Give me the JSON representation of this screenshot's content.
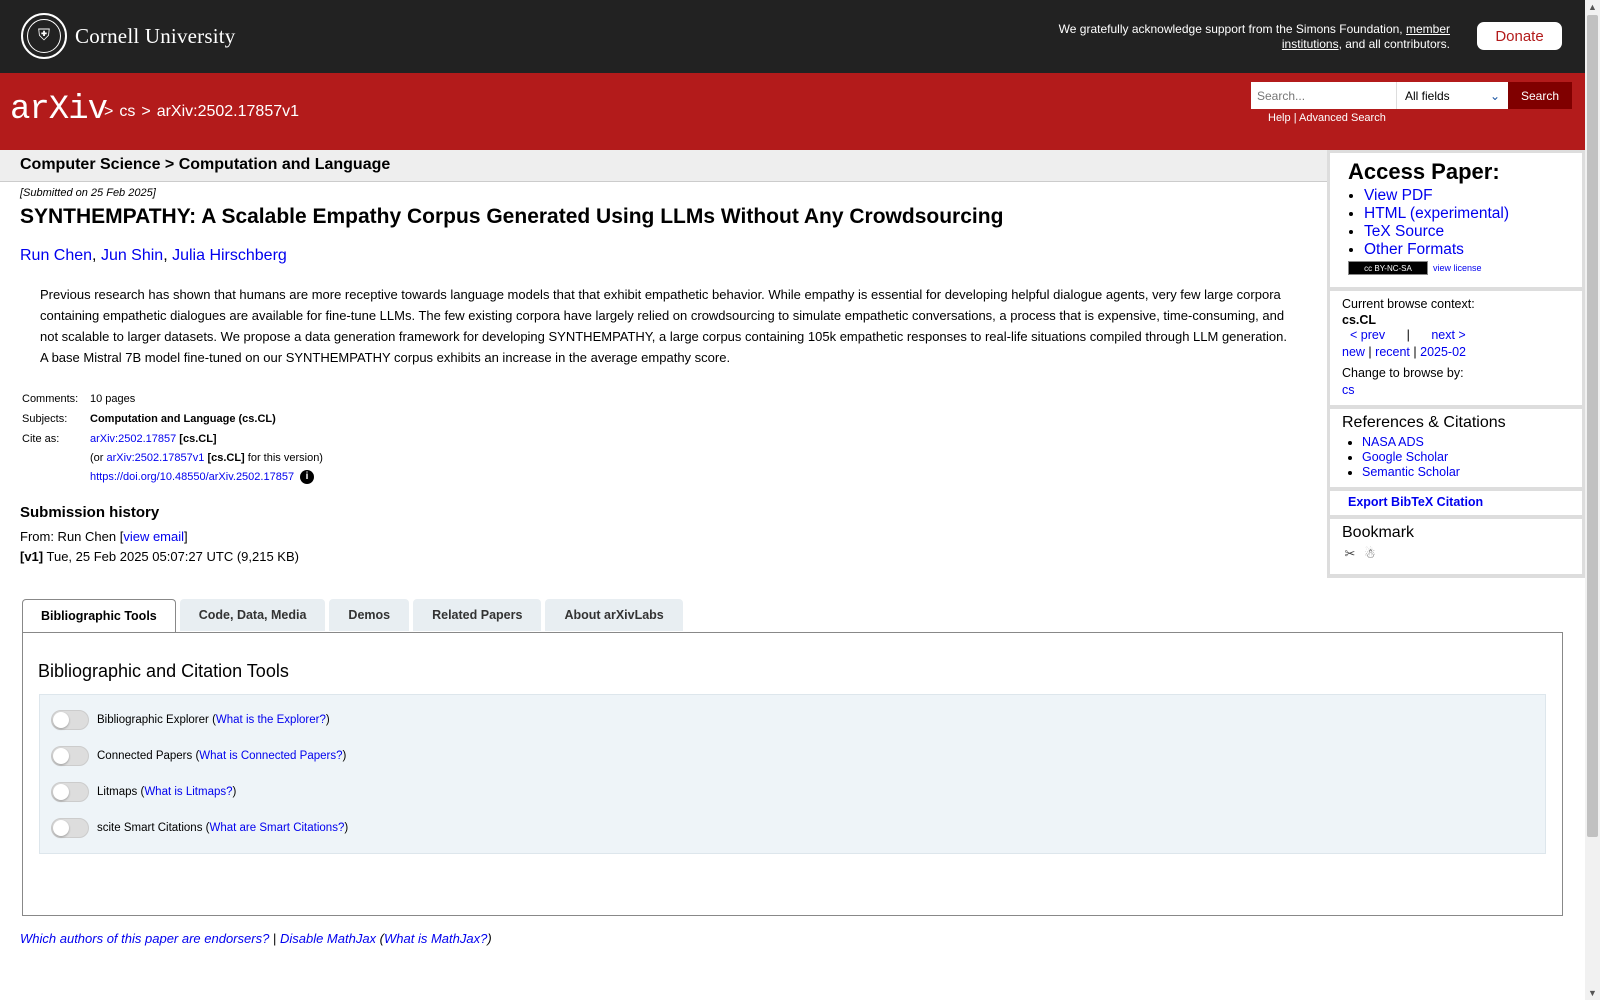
{
  "header": {
    "institution": "Cornell University",
    "support_text": "We gratefully acknowledge support from the Simons Foundation,",
    "member_link": "member institutions",
    "support_suffix": ", and all contributors.",
    "donate": "Donate"
  },
  "nav": {
    "logo": "arXiv",
    "crumb_sep1": ">",
    "crumb_cs": "cs",
    "crumb_sep2": ">",
    "crumb_id": "arXiv:2502.17857v1",
    "search_placeholder": "Search...",
    "search_field": "All fields",
    "search_button": "Search",
    "help": "Help",
    "advanced": "Advanced Search",
    "help_sep": "|"
  },
  "category_band": "Computer Science > Computation and Language",
  "paper": {
    "submitted": "[Submitted on 25 Feb 2025]",
    "title": "SYNTHEMPATHY: A Scalable Empathy Corpus Generated Using LLMs Without Any Crowdsourcing",
    "authors": [
      "Run Chen",
      "Jun Shin",
      "Julia Hirschberg"
    ],
    "abstract": "Previous research has shown that humans are more receptive towards language models that that exhibit empathetic behavior. While empathy is essential for developing helpful dialogue agents, very few large corpora containing empathetic dialogues are available for fine-tune LLMs. The few existing corpora have largely relied on crowdsourcing to simulate empathetic conversations, a process that is expensive, time-consuming, and not scalable to larger datasets. We propose a data generation framework for developing SYNTHEMPATHY, a large corpus containing 105k empathetic responses to real-life situations compiled through LLM generation. A base Mistral 7B model fine-tuned on our SYNTHEMPATHY corpus exhibits an increase in the average empathy score."
  },
  "meta": {
    "comments_label": "Comments:",
    "comments": "10 pages",
    "subjects_label": "Subjects:",
    "subjects": "Computation and Language (cs.CL)",
    "cite_label": "Cite as:",
    "cite_id": "arXiv:2502.17857",
    "cite_cat": "[cs.CL]",
    "or_prefix": "(or",
    "cite_version": "arXiv:2502.17857v1",
    "cite_version_cat": "[cs.CL]",
    "for_version": "for this version)",
    "doi": "https://doi.org/10.48550/arXiv.2502.17857",
    "info_icon": "i"
  },
  "history": {
    "heading": "Submission history",
    "from_prefix": "From: Run Chen [",
    "view_email": "view email",
    "from_suffix": "]",
    "v1_label": "[v1]",
    "v1_text": "Tue, 25 Feb 2025 05:07:27 UTC (9,215 KB)"
  },
  "sidebar": {
    "access_title": "Access Paper:",
    "access_links": [
      "View PDF",
      "HTML (experimental)",
      "TeX Source",
      "Other Formats"
    ],
    "license_badge": "cc BY-NC-SA",
    "view_license": "view license",
    "browse_context_label": "Current browse context:",
    "browse_context": "cs.CL",
    "prev": "< prev",
    "browse_sep": "|",
    "next": "next >",
    "new": "new",
    "recent": "recent",
    "month": "2025-02",
    "change_browse": "Change to browse by:",
    "browse_cs": "cs",
    "refs_title": "References & Citations",
    "refs_links": [
      "NASA ADS",
      "Google Scholar",
      "Semantic Scholar"
    ],
    "bibtex": "Export BibTeX Citation",
    "bookmark_title": "Bookmark"
  },
  "tabs": [
    "Bibliographic Tools",
    "Code, Data, Media",
    "Demos",
    "Related Papers",
    "About arXivLabs"
  ],
  "tools": {
    "title": "Bibliographic and Citation Tools",
    "items": [
      {
        "name": "Bibliographic Explorer",
        "link": "What is the Explorer?"
      },
      {
        "name": "Connected Papers",
        "link": "What is Connected Papers?"
      },
      {
        "name": "Litmaps",
        "link": "What is Litmaps?"
      },
      {
        "name": "scite Smart Citations",
        "link": "What are Smart Citations?"
      }
    ]
  },
  "footer": {
    "endorsers": "Which authors of this paper are endorsers?",
    "sep": "|",
    "disable_mathjax": "Disable MathJax",
    "what_mathjax": "What is MathJax?"
  },
  "colors": {
    "brand_red": "#b31b1b",
    "topbar": "#222222",
    "link": "#0000ee"
  }
}
